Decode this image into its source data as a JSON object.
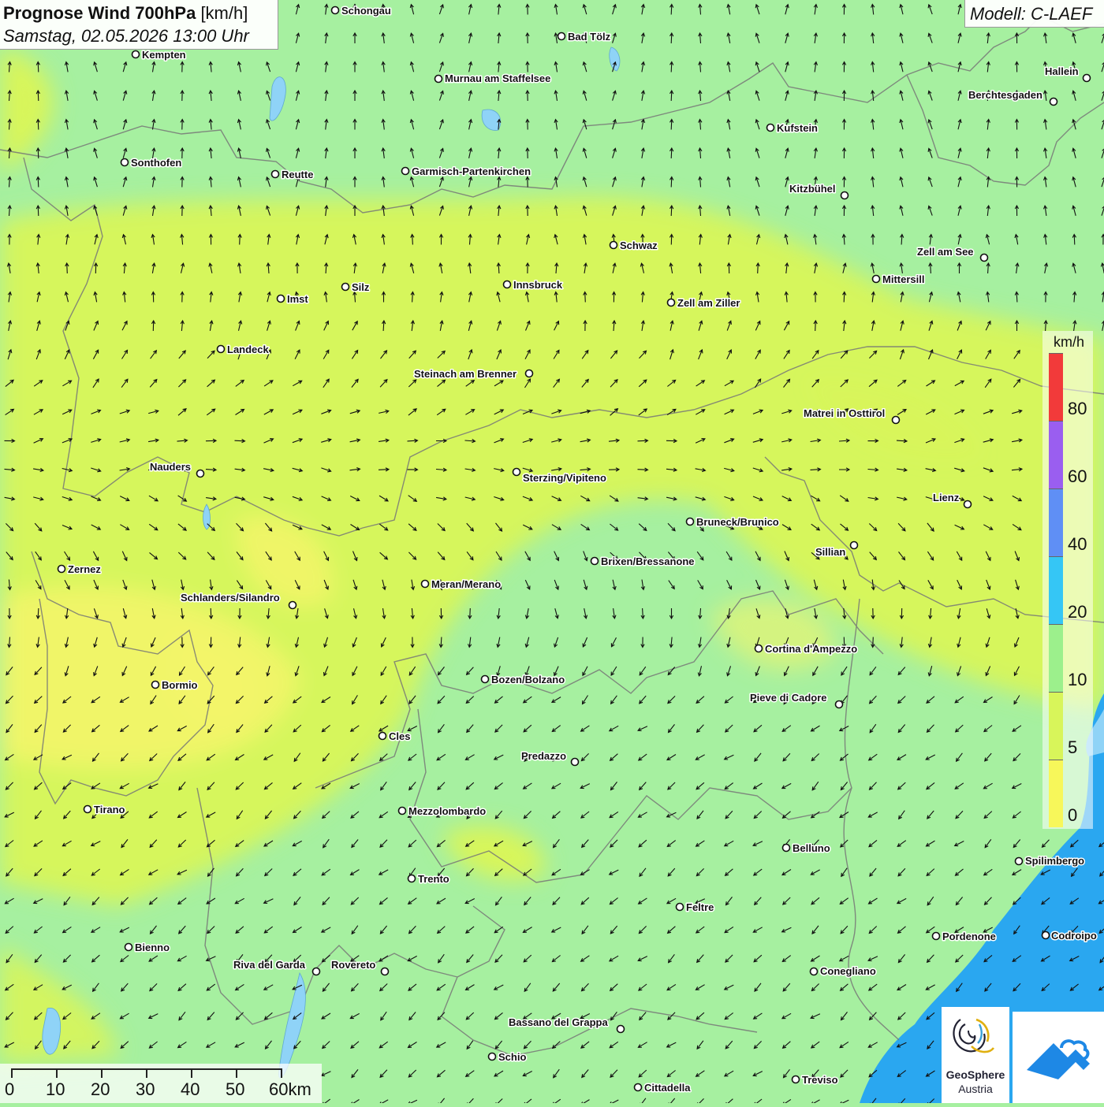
{
  "header": {
    "title_bold": "Prognose Wind 700hPa",
    "title_unit": "[km/h]",
    "datetime": "Samstag, 02.05.2026 13:00 Uhr",
    "model": "Modell: C-LAEF"
  },
  "map": {
    "cities": [
      {
        "name": "Schongau"
      },
      {
        "name": "Bad Tölz"
      },
      {
        "name": "Kempten"
      },
      {
        "name": "Murnau am Staffelsee"
      },
      {
        "name": "Hallein"
      },
      {
        "name": "Berchtesgaden"
      },
      {
        "name": "Kufstein"
      },
      {
        "name": "Sonthofen"
      },
      {
        "name": "Reutte"
      },
      {
        "name": "Garmisch-Partenkirchen"
      },
      {
        "name": "Kitzbühel"
      },
      {
        "name": "Schwaz"
      },
      {
        "name": "Zell am See"
      },
      {
        "name": "Mittersill"
      },
      {
        "name": "Innsbruck"
      },
      {
        "name": "Silz"
      },
      {
        "name": "Imst"
      },
      {
        "name": "Zell am Ziller"
      },
      {
        "name": "Landeck"
      },
      {
        "name": "Steinach am Brenner"
      },
      {
        "name": "Matrei in Osttirol"
      },
      {
        "name": "Nauders"
      },
      {
        "name": "Sterzing/Vipiteno"
      },
      {
        "name": "Lienz"
      },
      {
        "name": "Bruneck/Brunico"
      },
      {
        "name": "Sillian"
      },
      {
        "name": "Brixen/Bressanone"
      },
      {
        "name": "Zernez"
      },
      {
        "name": "Meran/Merano"
      },
      {
        "name": "Schlanders/Silandro"
      },
      {
        "name": "Cortina d'Ampezzo"
      },
      {
        "name": "Bozen/Bolzano"
      },
      {
        "name": "Bormio"
      },
      {
        "name": "Pieve di Cadore"
      },
      {
        "name": "Cles"
      },
      {
        "name": "Predazzo"
      },
      {
        "name": "Tirano"
      },
      {
        "name": "Mezzolombardo"
      },
      {
        "name": "Belluno"
      },
      {
        "name": "Spilimbergo"
      },
      {
        "name": "Trento"
      },
      {
        "name": "Feltre"
      },
      {
        "name": "Pordenone"
      },
      {
        "name": "Codroipo"
      },
      {
        "name": "Bienno"
      },
      {
        "name": "Riva del Garda"
      },
      {
        "name": "Rovereto"
      },
      {
        "name": "Conegliano"
      },
      {
        "name": "Bassano del Grappa"
      },
      {
        "name": "Schio"
      },
      {
        "name": "Treviso"
      },
      {
        "name": "Cittadella"
      }
    ]
  },
  "legend": {
    "unit": "km/h",
    "ticks": [
      "80",
      "60",
      "40",
      "20",
      "10",
      "5",
      "0"
    ],
    "colors": [
      "#f23a3a",
      "#9a5ef0",
      "#5f8ff5",
      "#35c6f5",
      "#9cf08c",
      "#d8f55a",
      "#f7f75a"
    ]
  },
  "scale_bar": {
    "labels": [
      "0",
      "10",
      "20",
      "30",
      "40",
      "50",
      "60km"
    ]
  },
  "logos": {
    "geosphere_name": "GeoSphere",
    "geosphere_sub": "Austria"
  },
  "colors": {
    "wind_low": "#f7f75a",
    "wind_mid": "#d8f55a",
    "wind_green": "#a6f0a0",
    "sea": "#2aa7f0",
    "border": "#777777"
  }
}
